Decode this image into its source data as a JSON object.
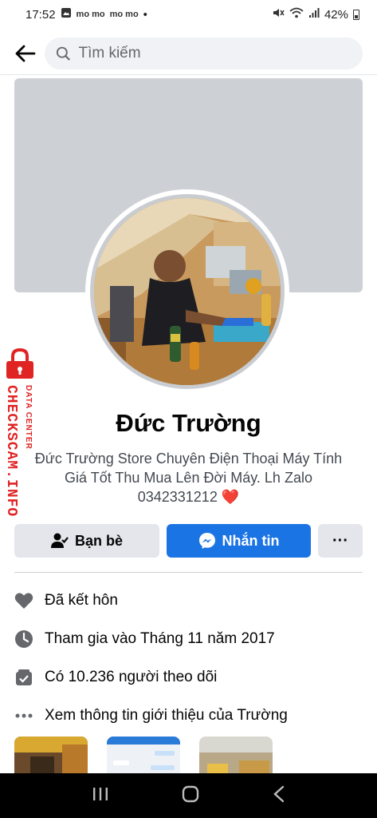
{
  "status_bar": {
    "time": "17:52",
    "left_icons": [
      "image-icon",
      "momo-icon",
      "momo-icon",
      "dot-icon"
    ],
    "momo_label": "mo mo",
    "battery": "42%"
  },
  "search": {
    "placeholder": "Tìm kiếm"
  },
  "profile": {
    "name": "Đức Trường",
    "bio": "Đức Trường Store Chuyên Điện Thoại Máy Tính Giá Tốt Thu Mua Lên Đời Máy. Lh Zalo 0342331212",
    "bio_emoji": "❤️"
  },
  "actions": {
    "friends_label": "Bạn bè",
    "message_label": "Nhắn tin",
    "more_label": "···"
  },
  "info": [
    {
      "icon": "heart-icon",
      "text": "Đã kết hôn"
    },
    {
      "icon": "clock-icon",
      "text": "Tham gia vào Tháng 11 năm 2017"
    },
    {
      "icon": "followers-icon",
      "text": "Có 10.236 người theo dõi"
    },
    {
      "icon": "more-dots-icon",
      "text": "Xem thông tin giới thiệu của Trường"
    }
  ],
  "watermark": {
    "big": "CHECKSCAM.INFO",
    "small": "DATA CENTER"
  },
  "colors": {
    "accent": "#1b74e4",
    "watermark": "#e02424",
    "heart": "#e41e3f"
  }
}
